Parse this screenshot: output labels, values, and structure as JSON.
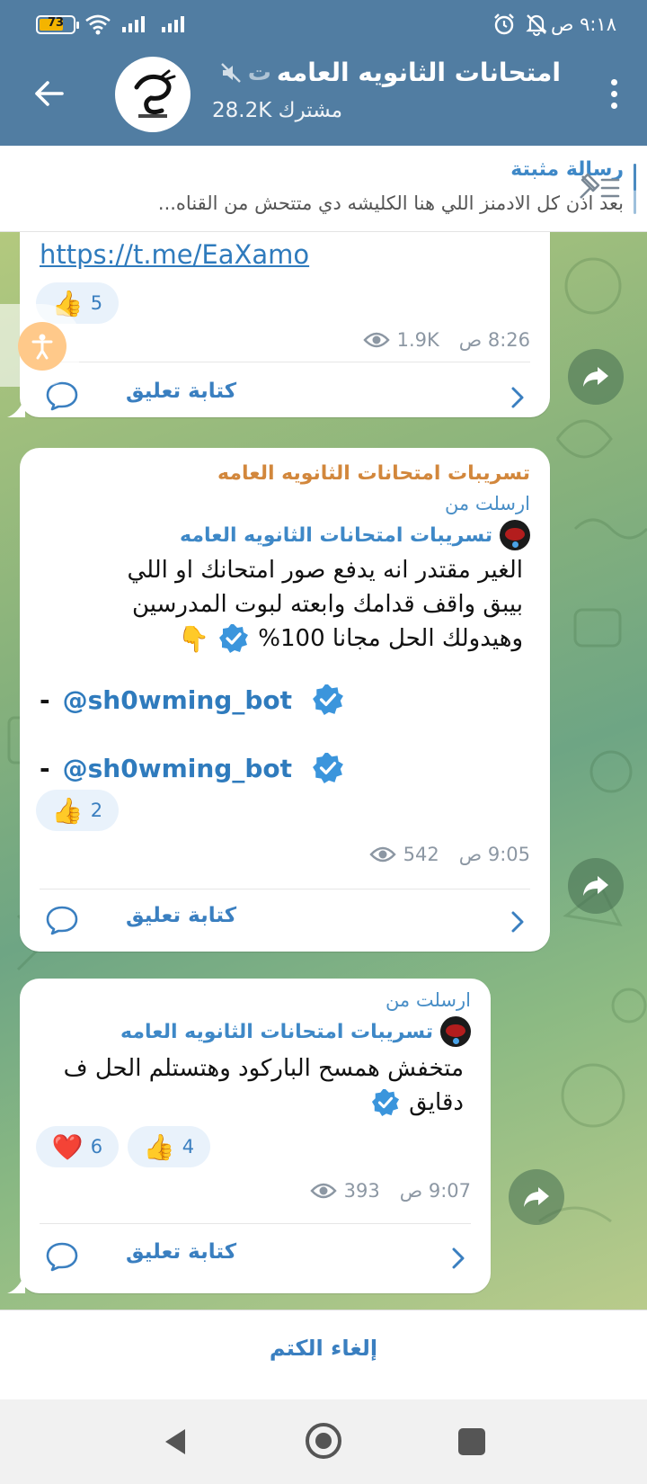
{
  "status_bar": {
    "battery": "73",
    "battery_level_percent": 73,
    "clock": "٩:١٨ ص"
  },
  "header": {
    "channel_title": "امتحانات الثانويه العامه",
    "channel_title_suffix": "ت",
    "subscribers": "28.2K مشترك",
    "icons": [
      "back-arrow-icon",
      "channel-avatar",
      "mute-icon",
      "more-vertical-icon"
    ]
  },
  "pinned": {
    "title": "رسالة مثبتة",
    "preview": "بعد اذن كل الادمنز اللي هنا الكليشه دي متتحش من القناه..."
  },
  "messages": [
    {
      "link": "https://t.me/EaXamo",
      "reactions": [
        {
          "emoji": "👍",
          "count": "5"
        }
      ],
      "views": "1.9K",
      "time": "8:26 ص",
      "comment_label": "كتابة تعليق"
    },
    {
      "sender": "تسريبات امتحانات الثانويه العامه",
      "forwarded_label": "ارسلت من",
      "forwarded_from": "تسريبات امتحانات الثانويه العامه",
      "text_lines": [
        "الغير مقتدر انه يدفع صور امتحانك او اللي",
        "بيبق واقف قدامك وابعته لبوت المدرسين",
        "وهيدولك الحل مجانا 100%"
      ],
      "bot_lines": [
        {
          "dash": "-",
          "handle": "@sh0wming_bot"
        },
        {
          "dash": "-",
          "handle": "@sh0wming_bot"
        }
      ],
      "reactions": [
        {
          "emoji": "👍",
          "count": "2"
        }
      ],
      "views": "542",
      "time": "9:05 ص",
      "comment_label": "كتابة تعليق"
    },
    {
      "forwarded_label": "ارسلت من",
      "forwarded_from": "تسريبات امتحانات الثانويه العامه",
      "text_lines": [
        "متخفش همسح الباركود وهتستلم الحل ف",
        "دقايق"
      ],
      "reactions": [
        {
          "emoji": "❤️",
          "count": "6"
        },
        {
          "emoji": "👍",
          "count": "4"
        }
      ],
      "views": "393",
      "time": "9:07 ص",
      "comment_label": "كتابة تعليق"
    }
  ],
  "bottom_bar": {
    "unmute_label": "إلغاء الكتم"
  },
  "colors": {
    "header": "#517da2",
    "accent_blue": "#3a7fc0",
    "sender_orange": "#d2873c",
    "chat_green": "#86b17c"
  }
}
